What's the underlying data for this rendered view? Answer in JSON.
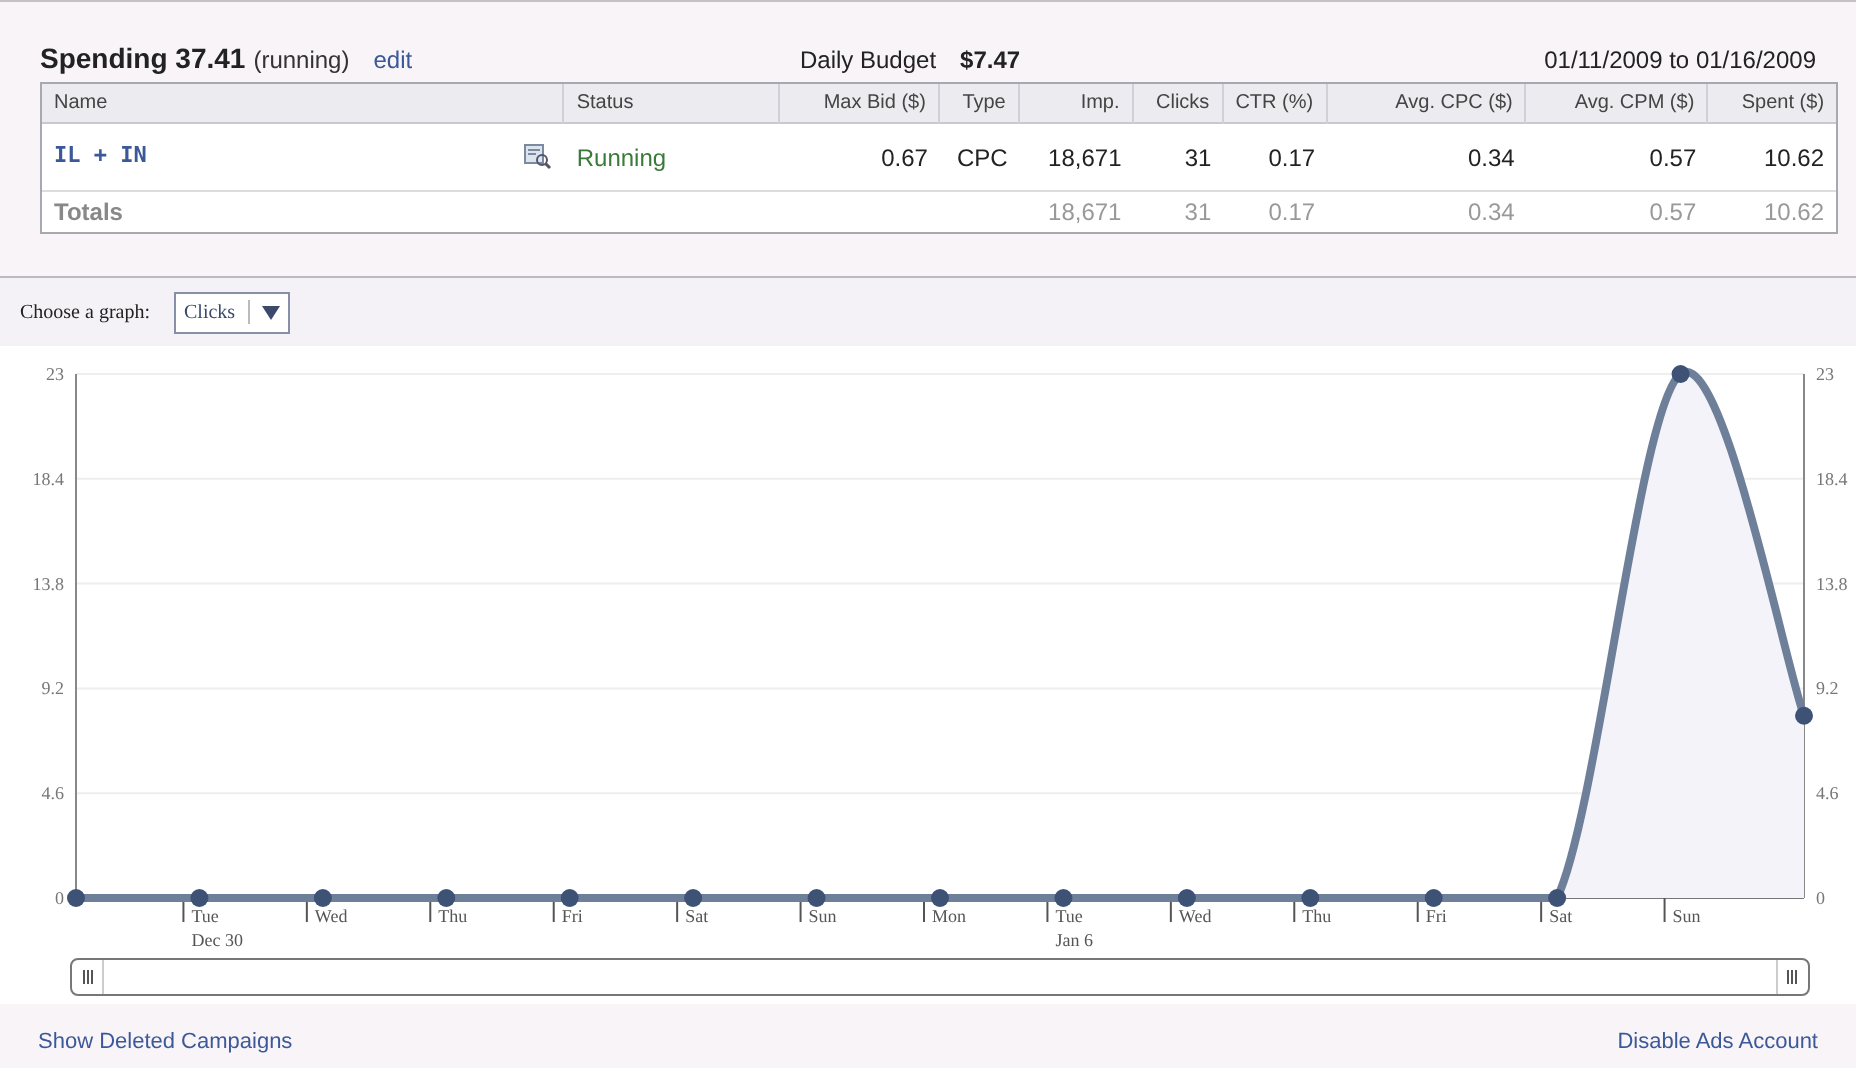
{
  "header": {
    "title": "Spending 37.41",
    "state": "(running)",
    "edit_link": "edit",
    "budget_label": "Daily Budget",
    "budget_value": "$7.47",
    "date_range": "01/11/2009 to 01/16/2009"
  },
  "table": {
    "columns": [
      "Name",
      "Status",
      "Max Bid ($)",
      "Type",
      "Imp.",
      "Clicks",
      "CTR (%)",
      "Avg. CPC ($)",
      "Avg. CPM ($)",
      "Spent ($)"
    ],
    "rows": [
      {
        "name": "IL + IN",
        "status": "Running",
        "max_bid": "0.67",
        "type": "CPC",
        "imp": "18,671",
        "clicks": "31",
        "ctr": "0.17",
        "avg_cpc": "0.34",
        "avg_cpm": "0.57",
        "spent": "10.62"
      }
    ],
    "totals": {
      "label": "Totals",
      "imp": "18,671",
      "clicks": "31",
      "ctr": "0.17",
      "avg_cpc": "0.34",
      "avg_cpm": "0.57",
      "spent": "10.62"
    }
  },
  "graph_picker": {
    "label": "Choose a graph:"
  },
  "chart": {
    "right_axis_labels": [
      "23",
      "18.4",
      "13.8",
      "9.2",
      "4.6",
      "0"
    ],
    "chart_data": {
      "type": "line",
      "categories": [
        null,
        "Tue\nDec 30",
        "Wed",
        "Thu",
        "Fri",
        "Sat",
        "Sun",
        "Mon",
        "Tue\nJan 6",
        "Wed",
        "Thu",
        "Fri",
        "Sat",
        "Sun",
        null
      ],
      "grid": true,
      "series": [
        {
          "name": "Clicks",
          "color": "#6e7f99",
          "marker": true,
          "values": [
            0,
            0,
            0,
            0,
            0,
            0,
            0,
            0,
            0,
            0,
            0,
            0,
            0,
            23,
            8
          ]
        }
      ],
      "ylim": [
        0,
        23
      ],
      "yticks": [
        0,
        4.6,
        9.2,
        13.8,
        18.4,
        23
      ]
    }
  },
  "footer": {
    "left_link": "Show Deleted Campaigns",
    "right_link": "Disable Ads Account"
  }
}
